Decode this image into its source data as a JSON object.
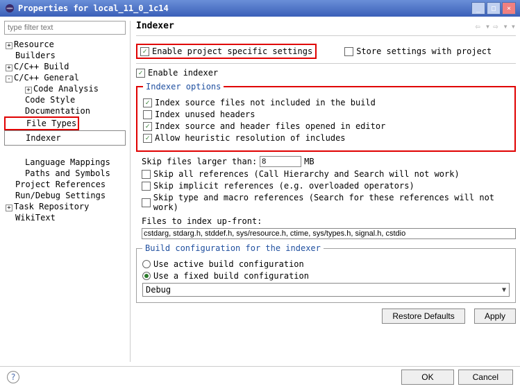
{
  "window": {
    "title": "Properties for local_11_0_1c14",
    "min": "_",
    "max": "□",
    "close": "×"
  },
  "filter": {
    "placeholder": "type filter text"
  },
  "tree": {
    "resource": "Resource",
    "builders": "Builders",
    "cbuild": "C/C++ Build",
    "cgeneral": "C/C++ General",
    "codeanalysis": "Code Analysis",
    "codestyle": "Code Style",
    "documentation": "Documentation",
    "filetypes": "File Types",
    "indexer": "Indexer",
    "langmap": "Language Mappings",
    "paths": "Paths and Symbols",
    "projrefs": "Project References",
    "rundebug": "Run/Debug Settings",
    "taskrepo": "Task Repository",
    "wikitext": "WikiText"
  },
  "page": {
    "title": "Indexer",
    "enable_proj": "Enable project specific settings",
    "store": "Store settings with project",
    "enable_idx": "Enable indexer",
    "fs_options": "Indexer options",
    "idx_src_not_inc": "Index source files not included in the build",
    "idx_unused": "Index unused headers",
    "idx_editor": "Index source and header files opened in editor",
    "allow_heur": "Allow heuristic resolution of includes",
    "skip_larger": "Skip files larger than:",
    "skip_val": "8",
    "mb": "MB",
    "skip_all": "Skip all references (Call Hierarchy and Search will not work)",
    "skip_impl": "Skip implicit references (e.g. overloaded operators)",
    "skip_type": "Skip type and macro references (Search for these references will not work)",
    "files_upfront": "Files to index up-front:",
    "upfront_val": "cstdarg, stdarg.h, stddef.h, sys/resource.h, ctime, sys/types.h, signal.h, cstdio",
    "fs_build": "Build configuration for the indexer",
    "use_active": "Use active build configuration",
    "use_fixed": "Use a fixed build configuration",
    "config": "Debug",
    "restore": "Restore Defaults",
    "apply": "Apply",
    "ok": "OK",
    "cancel": "Cancel"
  }
}
